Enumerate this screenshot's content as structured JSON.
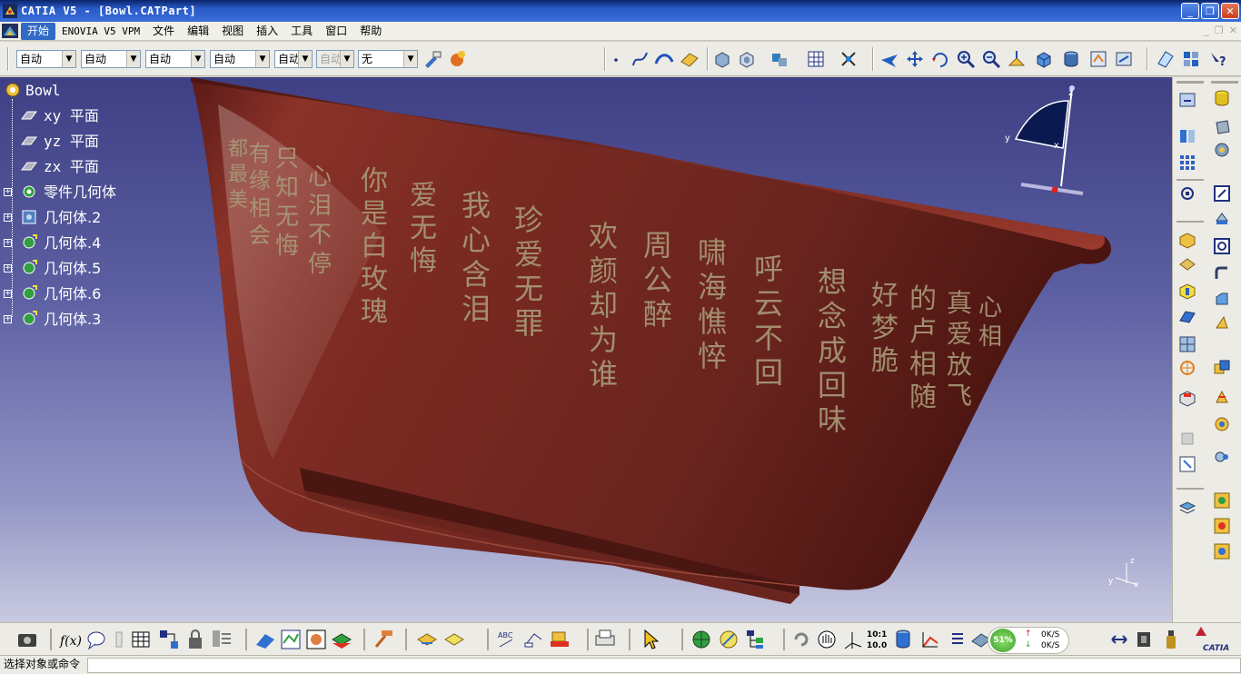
{
  "window": {
    "title": "CATIA V5 - [Bowl.CATPart]",
    "buttons": [
      "_",
      "❐",
      "✕"
    ]
  },
  "menu": {
    "items": [
      "开始",
      "ENOVIA V5 VPM",
      "文件",
      "编辑",
      "视图",
      "插入",
      "工具",
      "窗口",
      "帮助"
    ],
    "doc_buttons": [
      "_",
      "❐",
      "✕"
    ]
  },
  "toolbar": {
    "combos": [
      "自动",
      "自动",
      "自动",
      "自动",
      "自动",
      "自动",
      "无"
    ]
  },
  "tree": {
    "root": "Bowl",
    "items": [
      "xy 平面",
      "yz 平面",
      "zx 平面",
      "零件几何体",
      "几何体.2",
      "几何体.4",
      "几何体.5",
      "几何体.6",
      "几何体.3"
    ]
  },
  "engraving": {
    "columns": [
      "心泪不停",
      "只知无悔",
      "有缘相会",
      "都最美",
      "你是白玫瑰",
      "爱无悔",
      "我心含泪",
      "珍爱无罪",
      "欢颜却为谁",
      "周公醉",
      "啸海憔悴",
      "呼云不回",
      "想念成回味",
      "好梦脆",
      "的卢相随",
      "真爱放飞",
      "心相"
    ]
  },
  "compass": {
    "x_label": "x",
    "y_label": "y",
    "z_label": "z"
  },
  "axis_triad": {
    "x_label": "x",
    "y_label": "y",
    "z_label": "z"
  },
  "bottom_toolbar": {
    "scale_label_top": "10:1",
    "scale_label_bottom": "10.0",
    "memory_percent": "51%",
    "io_up": "0K/S",
    "io_down": "0K/S"
  },
  "brand": {
    "label": "CATIA"
  },
  "status": {
    "prompt": "选择对象或命令"
  },
  "colors": {
    "bowl": "#7a2a22",
    "engraving": "#a89a78",
    "viewport_top": "#3e3f84",
    "viewport_bottom": "#c9cae0"
  }
}
